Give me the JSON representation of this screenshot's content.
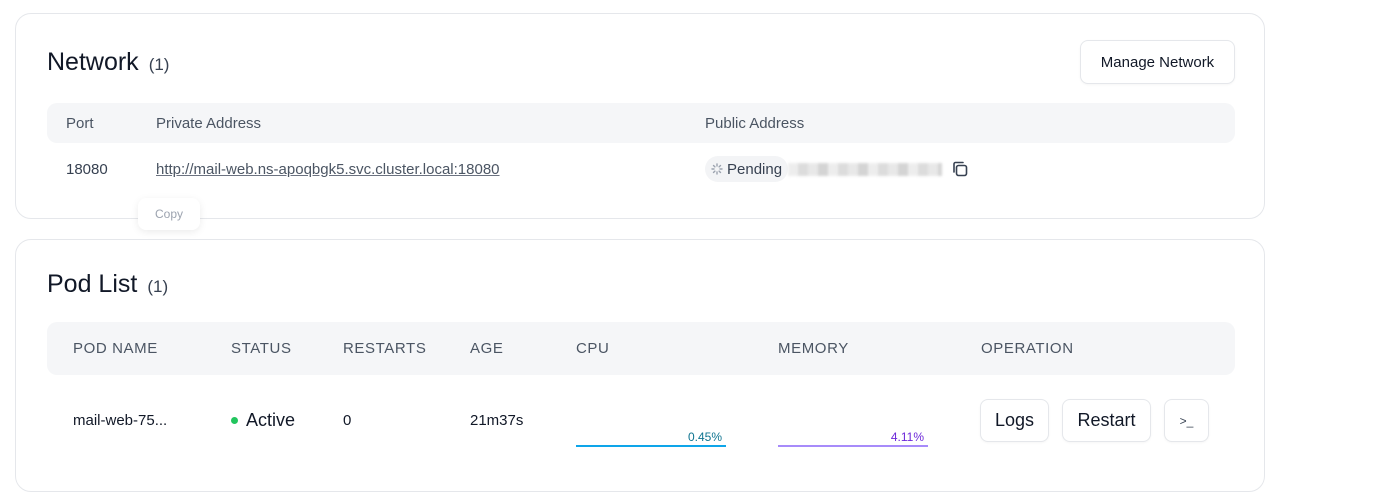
{
  "network": {
    "title": "Network",
    "count": "(1)",
    "manage_label": "Manage Network",
    "columns": {
      "port": "Port",
      "private": "Private Address",
      "public": "Public Address"
    },
    "row": {
      "port": "18080",
      "private_address": "http://mail-web.ns-apoqbgk5.svc.cluster.local:18080",
      "public_status": "Pending"
    },
    "tooltip": "Copy"
  },
  "pods": {
    "title": "Pod List",
    "count": "(1)",
    "columns": {
      "name": "POD NAME",
      "status": "STATUS",
      "restarts": "RESTARTS",
      "age": "AGE",
      "cpu": "CPU",
      "memory": "MEMORY",
      "operation": "OPERATION"
    },
    "row": {
      "name": "mail-web-75...",
      "status": "Active",
      "restarts": "0",
      "age": "21m37s",
      "cpu": "0.45%",
      "memory": "4.11%"
    },
    "operations": {
      "logs": "Logs",
      "restart": "Restart",
      "terminal": ">_"
    }
  },
  "colors": {
    "status_active": "#22c55e",
    "cpu_line": "#0ea5e9",
    "memory_line": "#a78bfa"
  },
  "icons": [
    "loading-spinner-icon",
    "copy-icon",
    "terminal-icon"
  ]
}
